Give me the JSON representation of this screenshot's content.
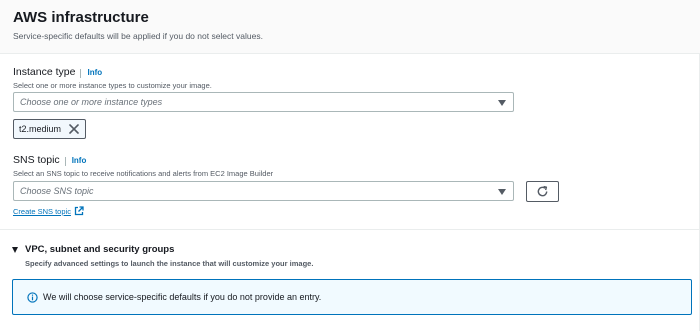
{
  "section": {
    "title": "AWS infrastructure",
    "description": "Service-specific defaults will be applied if you do not select values."
  },
  "instance_type": {
    "label": "Instance type",
    "info": "Info",
    "hint": "Select one or more instance types to customize your image.",
    "placeholder": "Choose one or more instance types",
    "selected_token": "t2.medium"
  },
  "sns_topic": {
    "label": "SNS topic",
    "info": "Info",
    "hint": "Select an SNS topic to receive notifications and alerts from EC2 Image Builder",
    "placeholder": "Choose SNS topic",
    "create_link": "Create SNS topic"
  },
  "vpc": {
    "title": "VPC, subnet and security groups",
    "description": "Specify advanced settings to launch the instance that will customize your image.",
    "alert": "We will choose service-specific defaults if you do not provide an entry."
  },
  "colors": {
    "link": "#0073bb",
    "text": "#16191f",
    "muted": "#545b64",
    "alert_bg": "#f1faff"
  },
  "icons": [
    "remove-token-icon",
    "refresh-icon",
    "external-link-icon",
    "expand-caret-icon",
    "info-circle-icon",
    "dropdown-caret-icon"
  ]
}
